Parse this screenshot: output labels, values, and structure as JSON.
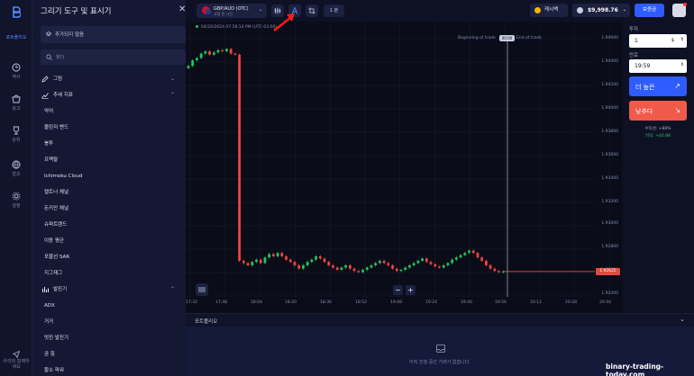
{
  "nav": {
    "items": [
      {
        "label": "포트폴리오",
        "icon": "logo-icon"
      },
      {
        "label": "역사",
        "icon": "history-icon"
      },
      {
        "label": "광고",
        "icon": "shop-icon"
      },
      {
        "label": "순위",
        "icon": "trophy-icon"
      },
      {
        "label": "협조",
        "icon": "globe-icon"
      },
      {
        "label": "설정",
        "icon": "gear-icon"
      }
    ],
    "bottom_line1": "우리와 함께하",
    "bottom_line2": "세요"
  },
  "panel": {
    "title": "그리기 도구 및 표시기",
    "favorites_label": "추가되지 않음",
    "search_placeholder": "찾다",
    "sections": [
      {
        "label": "그림",
        "items": []
      },
      {
        "label": "추세 지표",
        "items": [
          "악어",
          "볼린저 밴드",
          "봉투",
          "프랙탈",
          "Ichimoku Cloud",
          "켈트너 채널",
          "돈키안 채널",
          "슈퍼트렌드",
          "이동 평균",
          "포물선 SAR",
          "지그재그"
        ]
      },
      {
        "label": "발진기",
        "items": [
          "ADX",
          "거거",
          "멋진 발진기",
          "곰 힘",
          "황소 파워"
        ]
      }
    ]
  },
  "topbar": {
    "asset_name": "GBP/AUD (OTC)",
    "asset_sub": "고정 된 시간",
    "timeframe": "1 분",
    "cashback_label": "캐시백",
    "balance": "$9,998.76",
    "deposit_label": "보증금"
  },
  "chart": {
    "date_time": "04/20/2024  07:58:14 PM  (UTC-03:00)",
    "trade_begin_label": "Beginning of trade",
    "trade_badge": "00:00",
    "trade_end_label": "End of trade",
    "current_price": "1.92625",
    "price_ticks": [
      "1.94600",
      "1.94400",
      "1.94200",
      "1.94000",
      "1.93800",
      "1.93600",
      "1.93400",
      "1.93200",
      "1.93000",
      "1.92800",
      "1.92600",
      "1.92400"
    ],
    "time_ticks": [
      "17:32",
      "17:48",
      "18:04",
      "18:20",
      "18:36",
      "18:52",
      "19:08",
      "19:24",
      "19:40",
      "19:56",
      "20:12",
      "20:28",
      "20:44"
    ],
    "colors": {
      "up": "#22c55e",
      "down": "#ef4444",
      "price_line": "#e5483f"
    }
  },
  "chart_data": {
    "type": "candlestick",
    "xlabel": "",
    "ylabel": "",
    "ylim": [
      1.924,
      1.947
    ],
    "x_range": [
      "17:32",
      "20:44"
    ],
    "series": [
      {
        "values": [
          1.9445,
          1.945,
          1.9452,
          1.9456,
          1.9458,
          1.9455,
          1.9457,
          1.9459,
          1.9458,
          1.946,
          1.9456,
          1.9455,
          1.9272,
          1.927,
          1.9268,
          1.9271,
          1.9273,
          1.927,
          1.9275,
          1.9278,
          1.9276,
          1.9279,
          1.9276,
          1.9273,
          1.9271,
          1.9268,
          1.9265,
          1.9268,
          1.9271,
          1.9273,
          1.9276,
          1.9274,
          1.9271,
          1.9268,
          1.9266,
          1.9264,
          1.9266,
          1.9268,
          1.9265,
          1.9263,
          1.9262,
          1.9264,
          1.9266,
          1.9268,
          1.927,
          1.9272,
          1.927,
          1.9268,
          1.9265,
          1.9263,
          1.9264,
          1.9266,
          1.9268,
          1.927,
          1.9272,
          1.9274,
          1.9271,
          1.9269,
          1.9267,
          1.9266,
          1.9268,
          1.927,
          1.9273,
          1.9275,
          1.9277,
          1.9279,
          1.9281,
          1.9279,
          1.9275,
          1.9272,
          1.9268,
          1.9265,
          1.9263,
          1.9262,
          1.92625
        ]
      }
    ]
  },
  "trade": {
    "time_label": "투자",
    "amount": "1",
    "amount_suffix": "$",
    "expiry_label": "만료",
    "expiry": "19:59",
    "higher_label": "더 높은",
    "lower_label": "낮추다",
    "payout_label": "수익성: +88%",
    "profit_label": "이익: +$0.88"
  },
  "portfolio": {
    "title": "포트폴리오",
    "empty_text": "아직 진행 중인 거래가 없습니다."
  },
  "watermark": "binary-trading-today.com"
}
